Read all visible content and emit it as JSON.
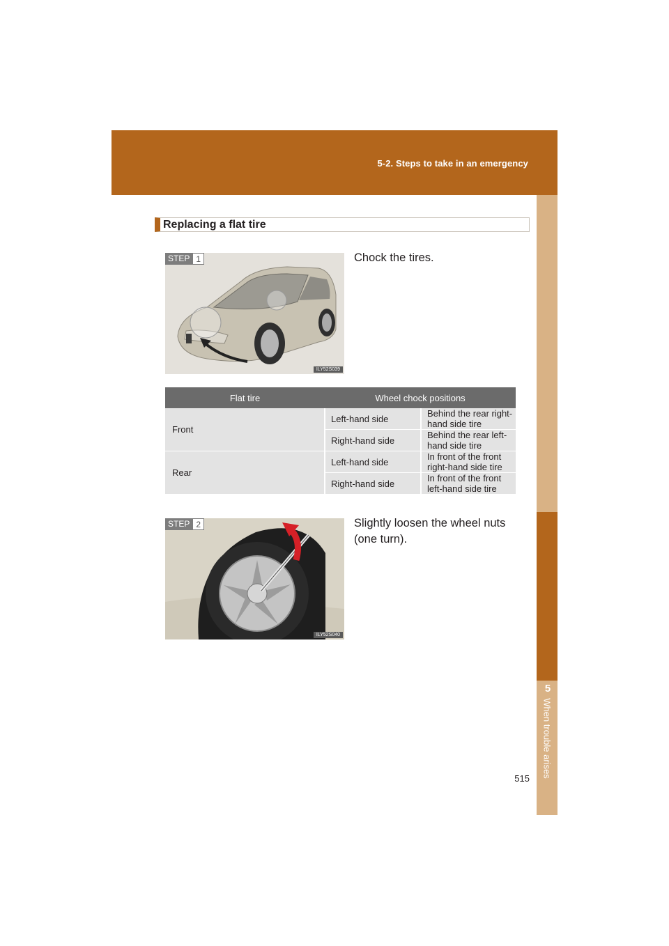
{
  "header": {
    "section": "5-2. Steps to take in an emergency"
  },
  "sidebar": {
    "chapter_number": "5",
    "chapter_name": "When trouble arises"
  },
  "page_number": "515",
  "subheading": "Replacing a flat tire",
  "step1": {
    "badge_label": "STEP",
    "badge_number": "1",
    "text": "Chock the tires.",
    "figure_code": "ILY52S039"
  },
  "table": {
    "headers": [
      "Flat tire",
      "Wheel chock positions"
    ],
    "rows": [
      {
        "group": "Front",
        "side": "Left-hand side",
        "position": "Behind the rear right-hand side tire"
      },
      {
        "group": "",
        "side": "Right-hand side",
        "position": "Behind the rear left-hand side tire"
      },
      {
        "group": "Rear",
        "side": "Left-hand side",
        "position": "In front of the front right-hand side tire"
      },
      {
        "group": "",
        "side": "Right-hand side",
        "position": "In front of the front left-hand side tire"
      }
    ]
  },
  "step2": {
    "badge_label": "STEP",
    "badge_number": "2",
    "text": "Slightly loosen the wheel nuts (one turn).",
    "figure_code": "ILY52S040"
  }
}
